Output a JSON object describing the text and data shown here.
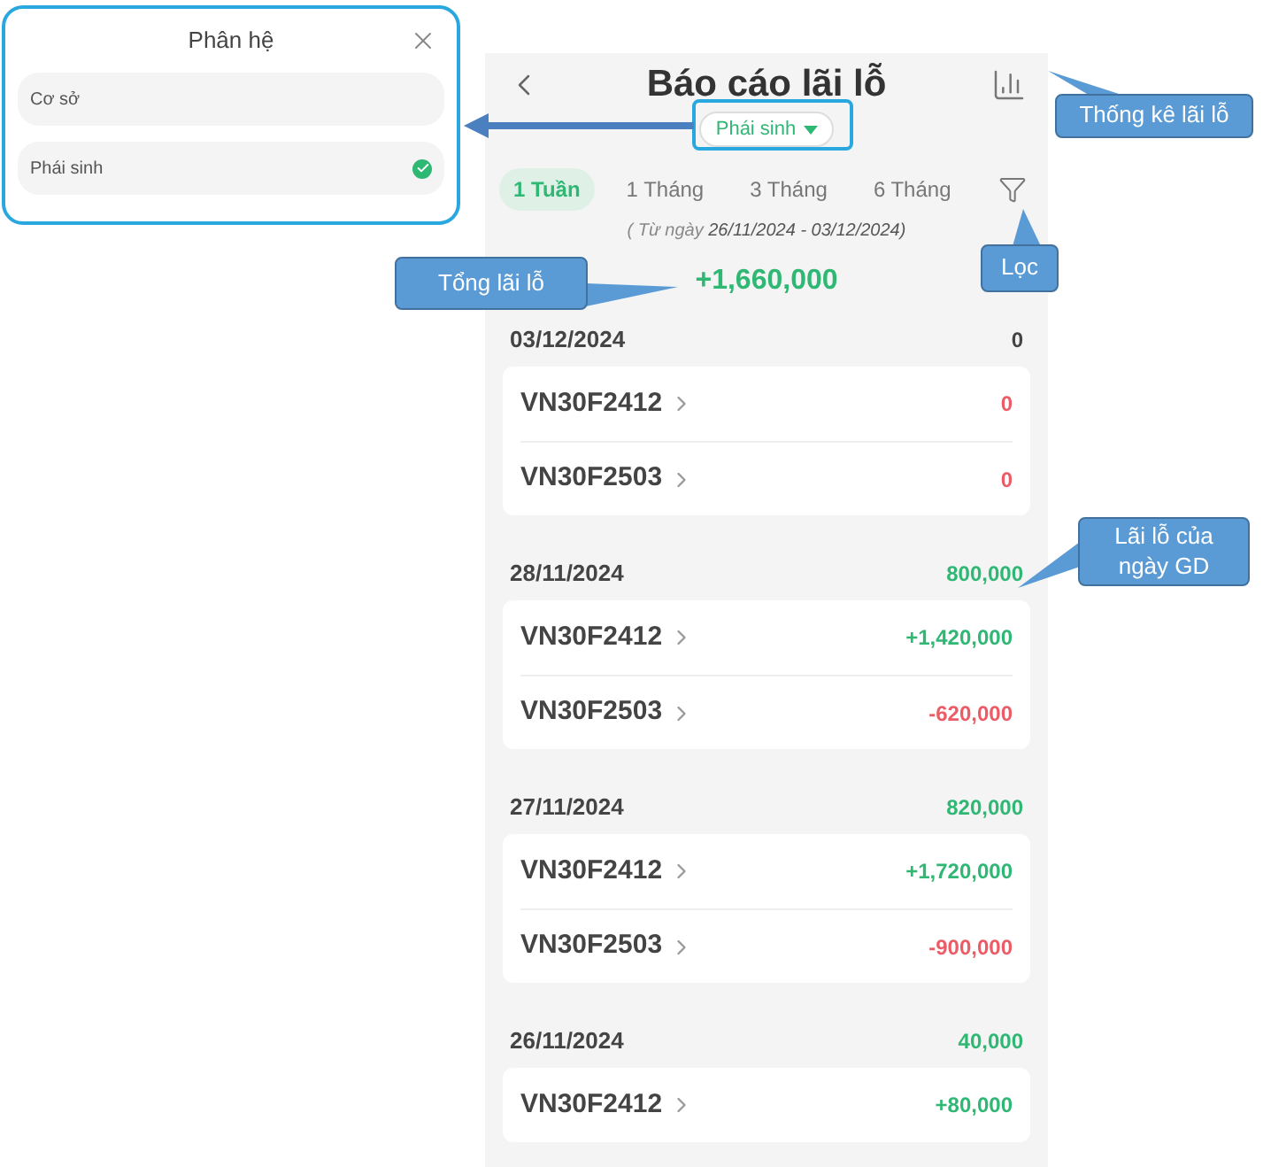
{
  "popup": {
    "title": "Phân hệ",
    "options": [
      {
        "label": "Cơ sở",
        "selected": false
      },
      {
        "label": "Phái sinh",
        "selected": true
      }
    ]
  },
  "screen": {
    "title": "Báo cáo lãi lỗ",
    "segment": "Phái sinh",
    "tabs": [
      {
        "label": "1 Tuần",
        "selected": true
      },
      {
        "label": "1 Tháng",
        "selected": false
      },
      {
        "label": "3 Tháng",
        "selected": false
      },
      {
        "label": "6 Tháng",
        "selected": false
      }
    ],
    "range_prefix": "( Từ ngày",
    "range": "26/11/2024 - 03/12/2024)",
    "total": {
      "value": "+1,660,000",
      "color": "#2fb774"
    },
    "days": [
      {
        "date": "03/12/2024",
        "value": "0",
        "color": "#444444",
        "rows": [
          {
            "symbol": "VN30F2412",
            "value": "0",
            "color": "#ec5b66"
          },
          {
            "symbol": "VN30F2503",
            "value": "0",
            "color": "#ec5b66"
          }
        ]
      },
      {
        "date": "28/11/2024",
        "value": "800,000",
        "color": "#2fb774",
        "rows": [
          {
            "symbol": "VN30F2412",
            "value": "+1,420,000",
            "color": "#2fb774"
          },
          {
            "symbol": "VN30F2503",
            "value": "-620,000",
            "color": "#ec5b66"
          }
        ]
      },
      {
        "date": "27/11/2024",
        "value": "820,000",
        "color": "#2fb774",
        "rows": [
          {
            "symbol": "VN30F2412",
            "value": "+1,720,000",
            "color": "#2fb774"
          },
          {
            "symbol": "VN30F2503",
            "value": "-900,000",
            "color": "#ec5b66"
          }
        ]
      },
      {
        "date": "26/11/2024",
        "value": "40,000",
        "color": "#2fb774",
        "rows": [
          {
            "symbol": "VN30F2412",
            "value": "+80,000",
            "color": "#2fb774"
          }
        ]
      }
    ]
  },
  "callouts": {
    "stats": "Thống kê lãi lỗ",
    "filter": "Lọc",
    "total": "Tổng lãi lỗ",
    "day": "Lãi lỗ của ngày GD"
  }
}
